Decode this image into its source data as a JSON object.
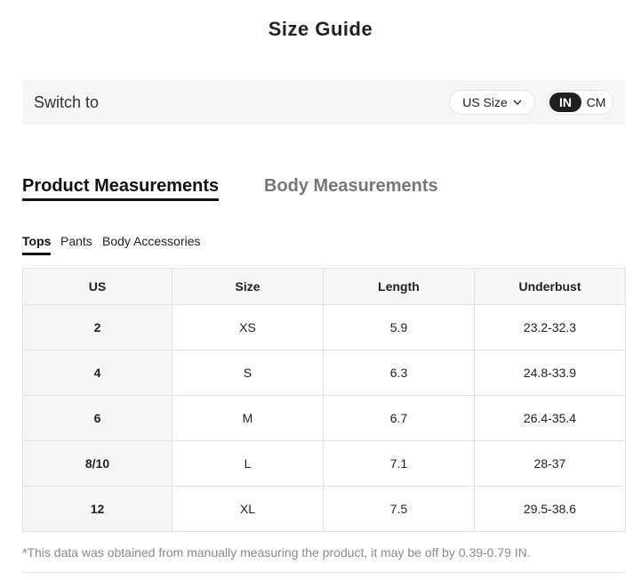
{
  "title": "Size Guide",
  "switch": {
    "label": "Switch to",
    "size_system": "US Size",
    "units": [
      {
        "label": "IN",
        "active": true
      },
      {
        "label": "CM",
        "active": false
      }
    ]
  },
  "main_tabs": [
    {
      "label": "Product Measurements",
      "active": true
    },
    {
      "label": "Body Measurements",
      "active": false
    }
  ],
  "sub_tabs": [
    {
      "label": "Tops",
      "active": true
    },
    {
      "label": "Pants",
      "active": false
    },
    {
      "label": "Body Accessories",
      "active": false
    }
  ],
  "table": {
    "headers": [
      "US",
      "Size",
      "Length",
      "Underbust"
    ],
    "rows": [
      [
        "2",
        "XS",
        "5.9",
        "23.2-32.3"
      ],
      [
        "4",
        "S",
        "6.3",
        "24.8-33.9"
      ],
      [
        "6",
        "M",
        "6.7",
        "26.4-35.4"
      ],
      [
        "8/10",
        "L",
        "7.1",
        "28-37"
      ],
      [
        "12",
        "XL",
        "7.5",
        "29.5-38.6"
      ]
    ]
  },
  "note": "*This data was obtained from manually measuring the product, it may be off by 0.39-0.79 IN.",
  "colors": {
    "panel_bg": "#f6f6f6",
    "active_toggle": "#1f1f1f",
    "inactive_tab": "#777777",
    "note_text": "#8a8a8a"
  }
}
